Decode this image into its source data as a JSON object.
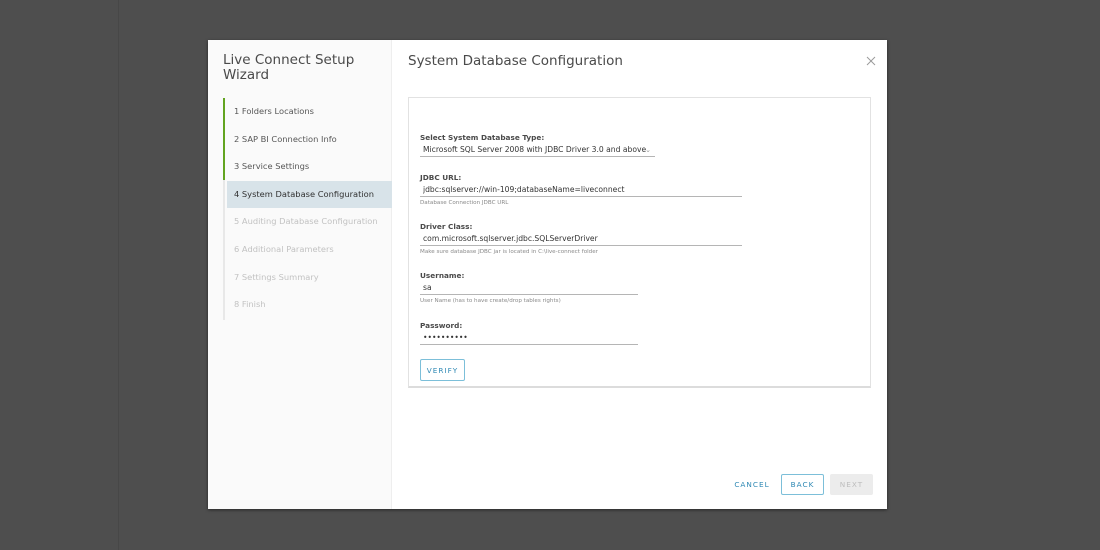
{
  "wizard": {
    "title": "Live Connect Setup Wizard",
    "steps": [
      {
        "label": "1 Folders Locations",
        "state": "done"
      },
      {
        "label": "2 SAP BI Connection Info",
        "state": "done"
      },
      {
        "label": "3 Service Settings",
        "state": "done"
      },
      {
        "label": "4 System Database Configuration",
        "state": "active"
      },
      {
        "label": "5 Auditing Database Configuration",
        "state": "disabled"
      },
      {
        "label": "6 Additional Parameters",
        "state": "disabled"
      },
      {
        "label": "7 Settings Summary",
        "state": "disabled"
      },
      {
        "label": "8 Finish",
        "state": "disabled"
      }
    ],
    "progress_color": "#62a420",
    "close_icon": "close-icon"
  },
  "page": {
    "title": "System Database Configuration"
  },
  "form": {
    "db_type": {
      "label": "Select System Database Type:",
      "selected": "Microsoft SQL Server 2008 with JDBC Driver 3.0 and above",
      "chevron": "⌄"
    },
    "jdbc_url": {
      "label": "JDBC URL:",
      "value": "jdbc:sqlserver://win-109;databaseName=liveconnect",
      "help": "Database Connection JDBC URL"
    },
    "driver_class": {
      "label": "Driver Class:",
      "value": "com.microsoft.sqlserver.jdbc.SQLServerDriver",
      "help": "Make sure database JDBC jar is located in C:\\live-connect folder"
    },
    "username": {
      "label": "Username:",
      "value": "sa",
      "help": "User Name (has to have create/drop tables rights)"
    },
    "password": {
      "label": "Password:",
      "value": "••••••••••"
    },
    "verify_label": "VERIFY"
  },
  "footer": {
    "cancel_label": "CANCEL",
    "back_label": "BACK",
    "next_label": "NEXT"
  },
  "colors": {
    "accent": "#2f89b4",
    "accent_border": "#7cbfd9",
    "active_step_bg": "#d8e3e9",
    "backdrop": "#4e4e4e"
  }
}
